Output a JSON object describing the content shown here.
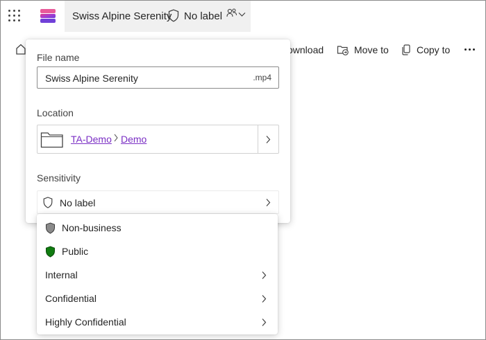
{
  "header": {
    "file_title": "Swiss Alpine Serenity",
    "sensitivity_label": "No label"
  },
  "toolbar": {
    "download_label": "ownload",
    "move_to_label": "Move to",
    "copy_to_label": "Copy to"
  },
  "details": {
    "file_name_label": "File name",
    "file_name_value": "Swiss Alpine Serenity",
    "file_extension": ".mp4",
    "location_label": "Location",
    "location_path": [
      "TA-Demo",
      "Demo"
    ],
    "sensitivity_label": "Sensitivity",
    "sensitivity_value": "No label"
  },
  "sensitivity_menu": {
    "items": [
      {
        "label": "Non-business",
        "icon": "gray-shield-icon",
        "submenu": false
      },
      {
        "label": "Public",
        "icon": "green-shield-icon",
        "submenu": false
      },
      {
        "label": "Internal",
        "submenu": true
      },
      {
        "label": "Confidential",
        "submenu": true
      },
      {
        "label": "Highly Confidential",
        "submenu": true
      }
    ]
  },
  "colors": {
    "accent_purple": "#7a2ec4",
    "public_green": "#107c10",
    "nonbusiness_gray": "#8a8a8a",
    "title_bg": "#f0f0f0"
  }
}
